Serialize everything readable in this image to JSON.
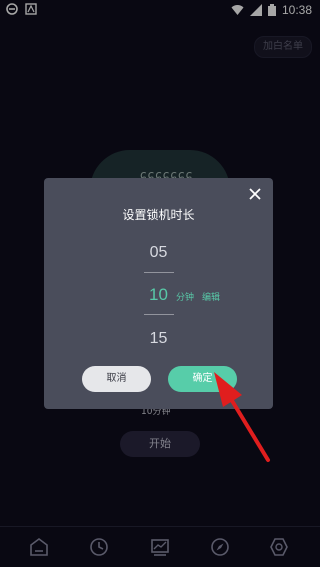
{
  "status_bar": {
    "time": "10:38"
  },
  "background": {
    "whitelist_label": "加白名单"
  },
  "dialog": {
    "title": "设置锁机时长",
    "picker_values": [
      "05",
      "10",
      "15"
    ],
    "unit": "分钟",
    "edit_label": "编辑",
    "cancel_label": "取消",
    "confirm_label": "确定"
  },
  "main": {
    "duration_text": "10分钟",
    "start_label": "开始"
  },
  "colors": {
    "accent": "#58c9a8",
    "dialog_bg": "#4a4d5b",
    "page_bg": "#0e0d1c",
    "arrow": "#e01e1e"
  }
}
